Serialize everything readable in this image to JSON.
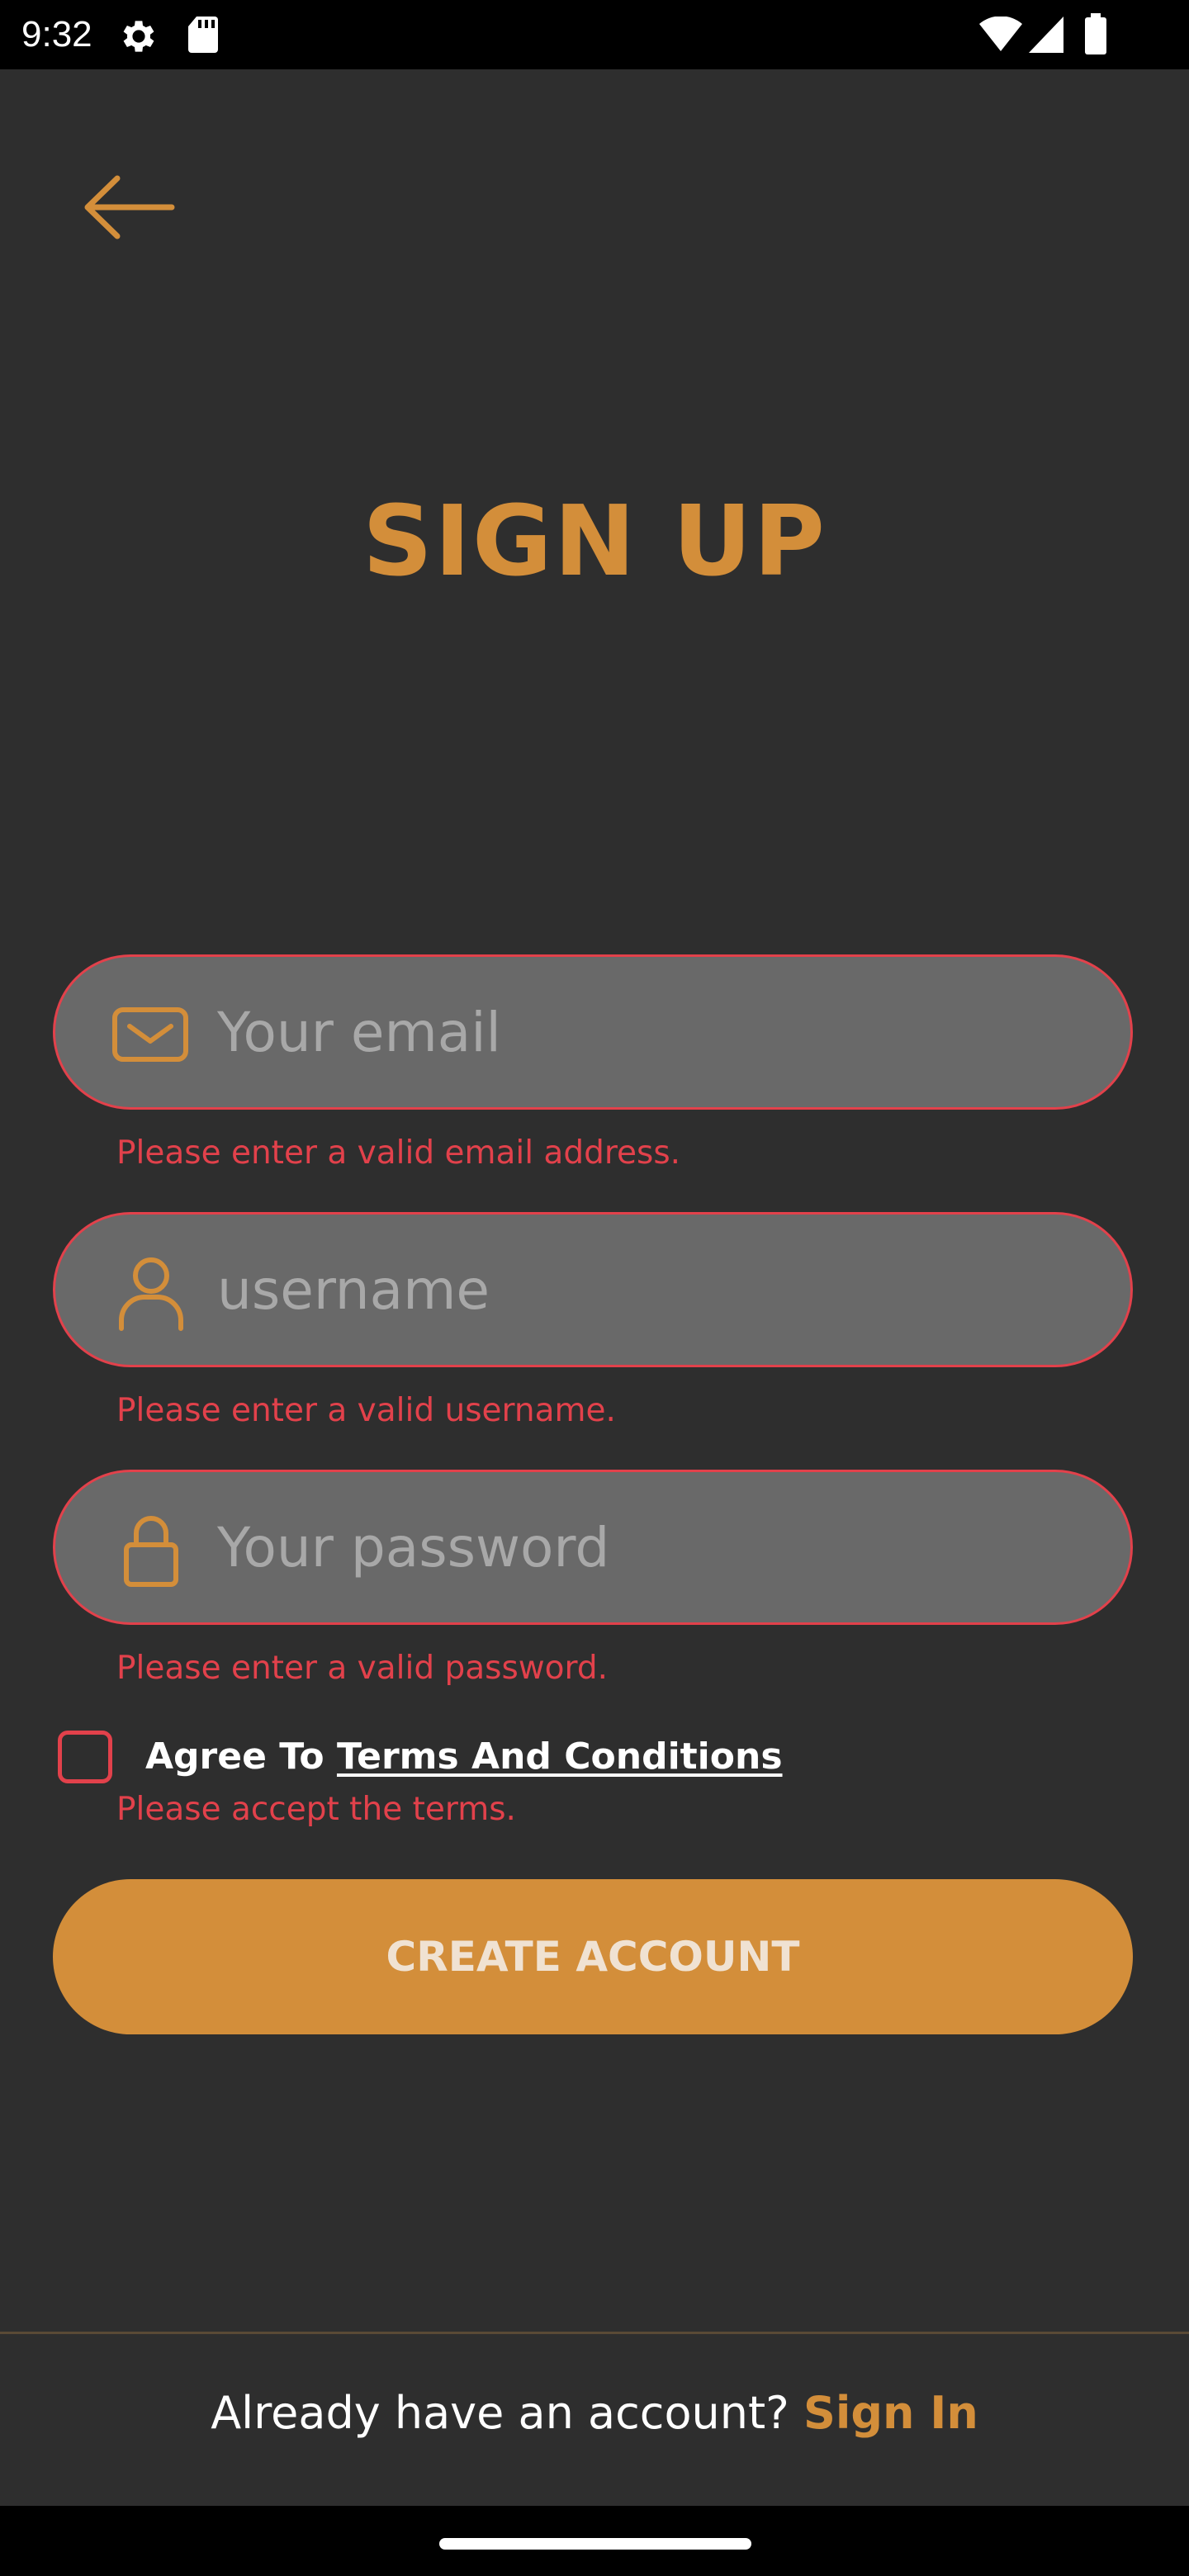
{
  "status_bar": {
    "time": "9:32",
    "icons": [
      "settings-icon",
      "sd-card-icon",
      "wifi-icon",
      "signal-icon",
      "battery-icon"
    ]
  },
  "header": {
    "back_icon": "arrow-left-icon",
    "title": "SIGN UP"
  },
  "form": {
    "email": {
      "icon": "mail-icon",
      "placeholder": "Your email",
      "error": "Please enter a valid email address."
    },
    "username": {
      "icon": "user-icon",
      "placeholder": "username",
      "error": "Please enter a valid username."
    },
    "password": {
      "icon": "lock-icon",
      "placeholder": "Your password",
      "error": "Please enter a valid password."
    },
    "terms": {
      "prefix": "Agree To ",
      "link": "Terms And Conditions",
      "checked": false,
      "error": "Please accept the terms."
    },
    "submit_label": "CREATE ACCOUNT"
  },
  "footer": {
    "prompt": "Already have an account? ",
    "link": "Sign In"
  },
  "colors": {
    "background": "#2e2e2e",
    "accent": "#d38e3a",
    "error": "#e2414b",
    "field_bg": "#696969"
  }
}
